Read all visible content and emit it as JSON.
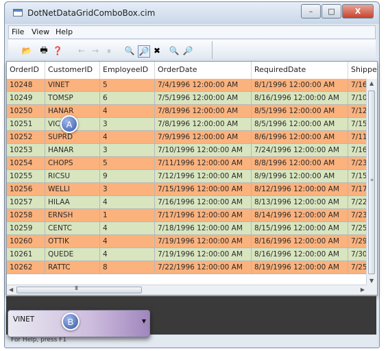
{
  "window": {
    "title": "DotNetDataGridComboBox.cim",
    "minimize": "–",
    "maximize": "□",
    "close": "X"
  },
  "menu": [
    "File",
    "View",
    "Help"
  ],
  "toolbar": {
    "icons": [
      "open-folder-icon",
      "print-preview-icon",
      "help-pointer-icon",
      "back-arrow-icon",
      "forward-arrow-icon",
      "stop-icon",
      "zoom-icon",
      "zoom-region-icon",
      "disconnect-icon",
      "zoom-in-icon",
      "zoom-out-icon"
    ],
    "glyphs": [
      "📂",
      "🖶",
      "❓",
      "←",
      "→",
      "⏸",
      "🔍",
      "🔎",
      "✖",
      "🔍",
      "🔎"
    ],
    "disabled": [
      false,
      false,
      false,
      true,
      true,
      true,
      false,
      false,
      false,
      true,
      true
    ]
  },
  "grid": {
    "columns": [
      "OrderID",
      "CustomerID",
      "EmployeeID",
      "OrderDate",
      "RequiredDate",
      "Shippe"
    ],
    "rows": [
      [
        "10248",
        "VINET",
        "5",
        "7/4/1996 12:00:00 AM",
        "8/1/1996 12:00:00 AM",
        "7/16/1"
      ],
      [
        "10249",
        "TOMSP",
        "6",
        "7/5/1996 12:00:00 AM",
        "8/16/1996 12:00:00 AM",
        "7/10/1"
      ],
      [
        "10250",
        "HANAR",
        "4",
        "7/8/1996 12:00:00 AM",
        "8/5/1996 12:00:00 AM",
        "7/12/1"
      ],
      [
        "10251",
        "VICTE",
        "3",
        "7/8/1996 12:00:00 AM",
        "8/5/1996 12:00:00 AM",
        "7/15/1"
      ],
      [
        "10252",
        "SUPRD",
        "4",
        "7/9/1996 12:00:00 AM",
        "8/6/1996 12:00:00 AM",
        "7/11/1"
      ],
      [
        "10253",
        "HANAR",
        "3",
        "7/10/1996 12:00:00 AM",
        "7/24/1996 12:00:00 AM",
        "7/16/1"
      ],
      [
        "10254",
        "CHOPS",
        "5",
        "7/11/1996 12:00:00 AM",
        "8/8/1996 12:00:00 AM",
        "7/23/1"
      ],
      [
        "10255",
        "RICSU",
        "9",
        "7/12/1996 12:00:00 AM",
        "8/9/1996 12:00:00 AM",
        "7/15/1"
      ],
      [
        "10256",
        "WELLI",
        "3",
        "7/15/1996 12:00:00 AM",
        "8/12/1996 12:00:00 AM",
        "7/17/1"
      ],
      [
        "10257",
        "HILAA",
        "4",
        "7/16/1996 12:00:00 AM",
        "8/13/1996 12:00:00 AM",
        "7/22/1"
      ],
      [
        "10258",
        "ERNSH",
        "1",
        "7/17/1996 12:00:00 AM",
        "8/14/1996 12:00:00 AM",
        "7/23/1"
      ],
      [
        "10259",
        "CENTC",
        "4",
        "7/18/1996 12:00:00 AM",
        "8/15/1996 12:00:00 AM",
        "7/25/1"
      ],
      [
        "10260",
        "OTTIK",
        "4",
        "7/19/1996 12:00:00 AM",
        "8/16/1996 12:00:00 AM",
        "7/29/1"
      ],
      [
        "10261",
        "QUEDE",
        "4",
        "7/19/1996 12:00:00 AM",
        "8/16/1996 12:00:00 AM",
        "7/30/1"
      ],
      [
        "10262",
        "RATTC",
        "8",
        "7/22/1996 12:00:00 AM",
        "8/19/1996 12:00:00 AM",
        "7/25/1"
      ]
    ],
    "row_colors": {
      "odd": "#fbb27d",
      "even": "#d8e5bf"
    },
    "scroll_grip": "III"
  },
  "combo": {
    "value": "VINET"
  },
  "callouts": {
    "a": "A",
    "b": "B"
  },
  "status": {
    "text": "For Help, press F1"
  }
}
